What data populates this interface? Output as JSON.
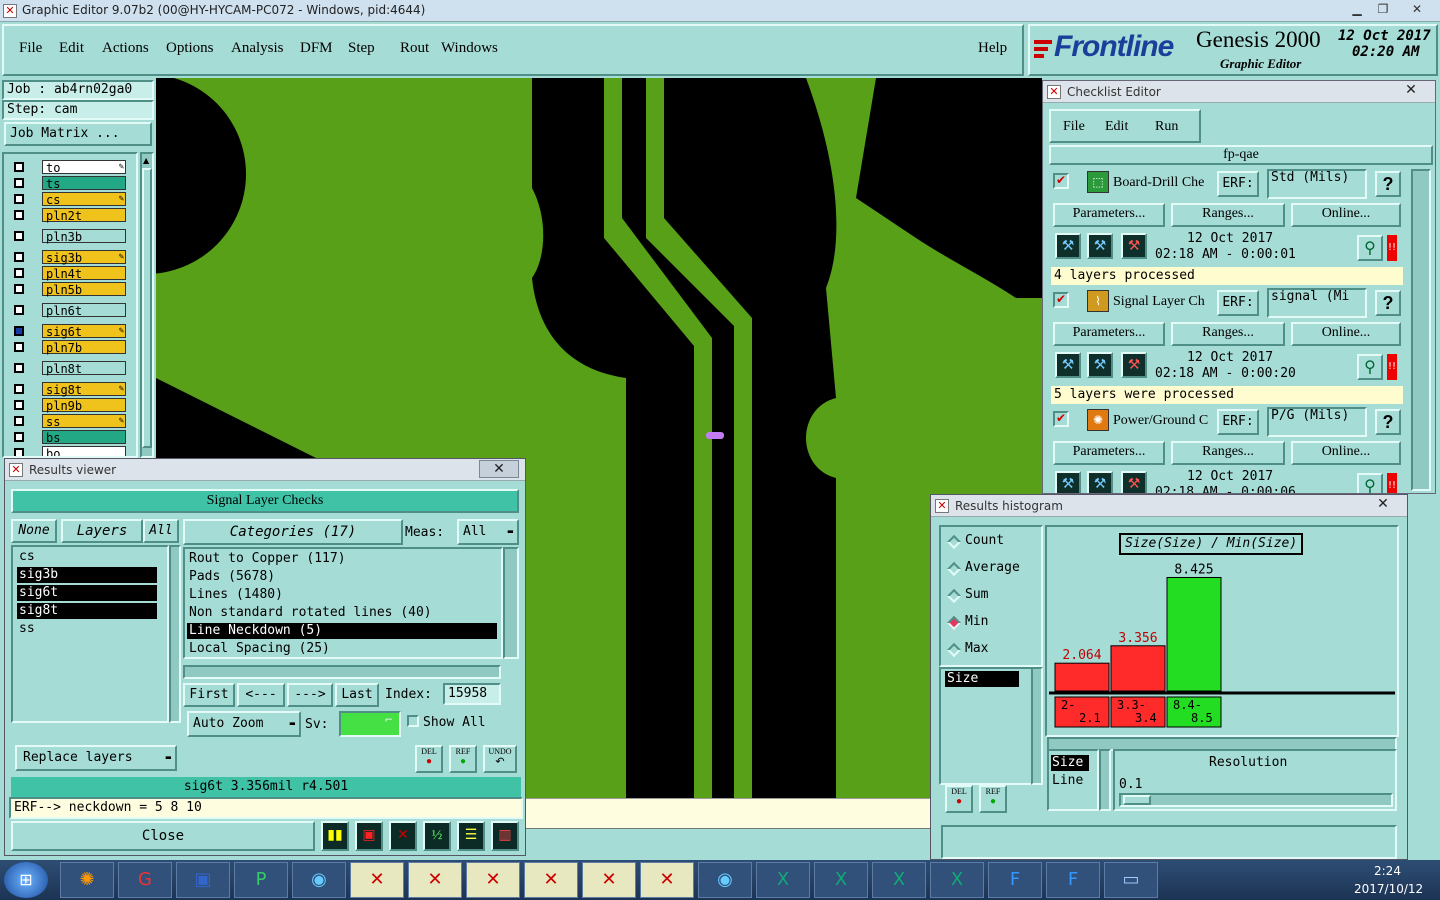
{
  "window": {
    "title": "Graphic Editor 9.07b2 (00@HY-HYCAM-PC072 - Windows, pid:4644)"
  },
  "menu": [
    "File",
    "Edit",
    "Actions",
    "Options",
    "Analysis",
    "DFM",
    "Step",
    "Rout",
    "Windows"
  ],
  "help": "Help",
  "brand": {
    "logo": "Frontline",
    "product": "Genesis 2000",
    "subtitle": "Graphic Editor",
    "date": "12 Oct 2017",
    "time": "02:20 AM"
  },
  "job": {
    "job": "Job : ab4rn02ga0",
    "step": "Step: cam",
    "matrix_btn": "Job Matrix ..."
  },
  "layers": [
    "to",
    "ts",
    "cs",
    "pln2t",
    "pln3b",
    "sig3b",
    "pln4t",
    "pln5b",
    "pln6t",
    "sig6t",
    "pln7b",
    "pln8t",
    "sig8t",
    "pln9b",
    "ss",
    "bs",
    "bo"
  ],
  "checklist": {
    "title": "Checklist Editor",
    "menu": [
      "File",
      "Edit",
      "Run"
    ],
    "name": "fp-qae",
    "actions": [
      {
        "name": "Board-Drill Che",
        "erf_label": "ERF:",
        "erf": "Std (Mils)",
        "date": "12 Oct 2017",
        "time": "02:18 AM - 0:00:01",
        "status": "4 layers processed"
      },
      {
        "name": "Signal Layer Ch",
        "erf_label": "ERF:",
        "erf": "signal (Mi",
        "date": "12 Oct 2017",
        "time": "02:18 AM - 0:00:20",
        "status": "5 layers were processed"
      },
      {
        "name": "Power/Ground C",
        "erf_label": "ERF:",
        "erf": "P/G (Mils)",
        "date": "12 Oct 2017",
        "time": "02:18 AM - 0:00:06",
        "status": ""
      }
    ],
    "btns": [
      "Parameters...",
      "Ranges...",
      "Online..."
    ],
    "help_q": "?"
  },
  "results_viewer": {
    "title": "Results viewer",
    "heading": "Signal Layer Checks",
    "none": "None",
    "layers": "Layers",
    "all": "All",
    "categories": "Categories (17)",
    "meas_label": "Meas:",
    "meas_value": "All",
    "layer_list": [
      "cs",
      "sig3b",
      "sig6t",
      "sig8t",
      "ss"
    ],
    "cat_list": [
      "Rout to Copper (117)",
      "Pads (5678)",
      "Lines (1480)",
      "Non standard rotated lines (40)",
      "Line Neckdown (5)",
      "Local Spacing (25)"
    ],
    "nav": [
      "First",
      "<---",
      "--->",
      "Last"
    ],
    "index_label": "Index:",
    "index_value": "15958",
    "autozoom": "Auto Zoom",
    "sv": "Sv:",
    "show_all": "Show All",
    "replace": "Replace layers",
    "del": "DEL",
    "ref": "REF",
    "undo": "UNDO",
    "info": "sig6t 3.356mil  r4.501",
    "erf_line": "ERF--> neckdown = 5 8 10",
    "close": "Close"
  },
  "histogram": {
    "title": "Results histogram",
    "modes": [
      "Count",
      "Average",
      "Sum",
      "Min",
      "Max"
    ],
    "selected_mode": "Min",
    "chart_title": "Size(Size) / Min(Size)",
    "list": [
      "Size"
    ],
    "res_list": [
      "Size",
      "Line"
    ],
    "resolution_label": "Resolution",
    "resolution": "0.1",
    "del": "DEL",
    "ref": "REF"
  },
  "chart_data": {
    "type": "bar",
    "title": "Size(Size) / Min(Size)",
    "categories": [
      "2-2.1",
      "3.3-3.4",
      "8.4-8.5"
    ],
    "values": [
      2.064,
      3.356,
      8.425
    ],
    "colors": [
      "#ff2a2a",
      "#ff2a2a",
      "#22dd22"
    ],
    "ylim": [
      0,
      9.5
    ]
  },
  "taskbar": {
    "time": "2:24",
    "date": "2017/10/12"
  },
  "colors": {
    "board": "#58a017",
    "background": "#a6dcd6",
    "title_dark": "#2a6e66"
  }
}
